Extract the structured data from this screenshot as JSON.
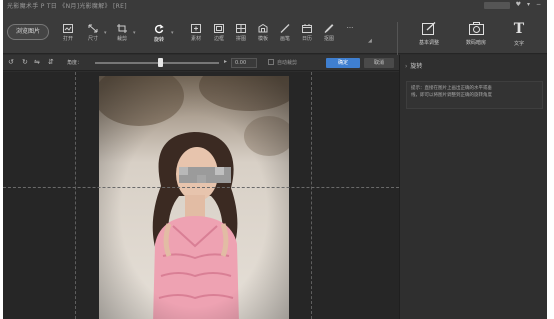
{
  "window": {
    "title": "光影魔术手 P T日 《N月]光影魔解》 [RE]"
  },
  "toolbar": {
    "open_label": "浏览图片",
    "tools": [
      {
        "id": "open",
        "label": "打开",
        "icon": "open-icon"
      },
      {
        "id": "size",
        "label": "尺寸",
        "icon": "resize-icon"
      },
      {
        "id": "crop",
        "label": "裁剪",
        "icon": "crop-icon"
      },
      {
        "id": "rotate",
        "label": "旋转",
        "icon": "rotate-icon",
        "active": true
      },
      {
        "id": "material",
        "label": "素材",
        "icon": "material-icon"
      },
      {
        "id": "border",
        "label": "边框",
        "icon": "border-icon"
      },
      {
        "id": "puzzle",
        "label": "拼图",
        "icon": "collage-icon"
      },
      {
        "id": "template",
        "label": "模板",
        "icon": "template-icon"
      },
      {
        "id": "watermark",
        "label": "画笔",
        "icon": "brush-icon"
      },
      {
        "id": "calendar",
        "label": "日历",
        "icon": "calendar-icon"
      },
      {
        "id": "pick",
        "label": "抠图",
        "icon": "pick-icon"
      },
      {
        "id": "more",
        "label": "···",
        "icon": "more-icon"
      }
    ],
    "right_tools": [
      {
        "id": "basic",
        "label": "基本调整",
        "icon": "adjust-icon"
      },
      {
        "id": "digital",
        "label": "数码暗房",
        "icon": "darkroom-icon"
      },
      {
        "id": "text",
        "label": "文字",
        "icon": "text-icon"
      }
    ]
  },
  "rotate_bar": {
    "angle_label": "角度：",
    "angle_value": "0.00",
    "auto_label": "自动裁剪",
    "confirm_label": "确定",
    "cancel_label": "取消"
  },
  "panel": {
    "title": "旋转",
    "hint_lines": [
      "提示：直接在图片上画出正确的水平或垂",
      "线，即可以将图片调整到正确的旋转角度"
    ]
  },
  "colors": {
    "accent": "#3f7fd0",
    "background": "#2d2d2d",
    "toolbar": "#3b3b3b"
  }
}
